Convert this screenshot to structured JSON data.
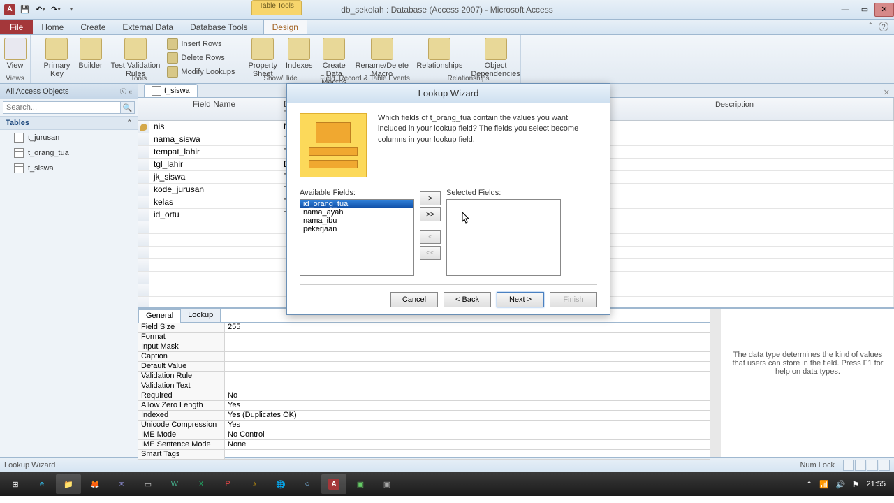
{
  "title": "db_sekolah : Database (Access 2007) - Microsoft Access",
  "tableTools": "Table Tools",
  "tabs": {
    "file": "File",
    "home": "Home",
    "create": "Create",
    "external": "External Data",
    "dbtools": "Database Tools",
    "design": "Design"
  },
  "ribbon": {
    "view": "View",
    "primaryKey": "Primary\nKey",
    "builder": "Builder",
    "testRules": "Test Validation\nRules",
    "insertRows": "Insert Rows",
    "deleteRows": "Delete Rows",
    "modifyLookups": "Modify Lookups",
    "propertySheet": "Property\nSheet",
    "indexes": "Indexes",
    "createMacros": "Create Data\nMacros ▾",
    "renameMacro": "Rename/Delete\nMacro",
    "relationships": "Relationships",
    "objectDeps": "Object\nDependencies",
    "groups": {
      "views": "Views",
      "tools": "Tools",
      "showhide": "Show/Hide",
      "fre": "Field, Record & Table Events",
      "rel": "Relationships"
    }
  },
  "nav": {
    "header": "All Access Objects",
    "searchPlaceholder": "Search...",
    "tables": "Tables",
    "items": [
      "t_jurusan",
      "t_orang_tua",
      "t_siswa"
    ]
  },
  "doc": {
    "tab": "t_siswa",
    "headers": {
      "field": "Field Name",
      "type": "Data Type",
      "desc": "Description"
    },
    "rows": [
      {
        "name": "nis",
        "type": "N",
        "pk": true
      },
      {
        "name": "nama_siswa",
        "type": "T"
      },
      {
        "name": "tempat_lahir",
        "type": "T"
      },
      {
        "name": "tgl_lahir",
        "type": "D"
      },
      {
        "name": "jk_siswa",
        "type": "T"
      },
      {
        "name": "kode_jurusan",
        "type": "T"
      },
      {
        "name": "kelas",
        "type": "T"
      },
      {
        "name": "id_ortu",
        "type": "T"
      }
    ]
  },
  "props": {
    "tabs": {
      "general": "General",
      "lookup": "Lookup"
    },
    "rows": [
      {
        "l": "Field Size",
        "v": "255"
      },
      {
        "l": "Format",
        "v": ""
      },
      {
        "l": "Input Mask",
        "v": ""
      },
      {
        "l": "Caption",
        "v": ""
      },
      {
        "l": "Default Value",
        "v": ""
      },
      {
        "l": "Validation Rule",
        "v": ""
      },
      {
        "l": "Validation Text",
        "v": ""
      },
      {
        "l": "Required",
        "v": "No"
      },
      {
        "l": "Allow Zero Length",
        "v": "Yes"
      },
      {
        "l": "Indexed",
        "v": "Yes (Duplicates OK)"
      },
      {
        "l": "Unicode Compression",
        "v": "Yes"
      },
      {
        "l": "IME Mode",
        "v": "No Control"
      },
      {
        "l": "IME Sentence Mode",
        "v": "None"
      },
      {
        "l": "Smart Tags",
        "v": ""
      }
    ],
    "help": "The data type determines the kind of values that users can store in the field. Press F1 for help on data types."
  },
  "wizard": {
    "title": "Lookup Wizard",
    "prompt": "Which fields of t_orang_tua contain the values you want included in your lookup field? The fields you select become columns in your lookup field.",
    "availLabel": "Available Fields:",
    "selLabel": "Selected Fields:",
    "available": [
      "id_orang_tua",
      "nama_ayah",
      "nama_ibu",
      "pekerjaan"
    ],
    "btns": {
      "add": ">",
      "addAll": ">>",
      "remove": "<",
      "removeAll": "<<"
    },
    "buttons": {
      "cancel": "Cancel",
      "back": "< Back",
      "next": "Next >",
      "finish": "Finish"
    }
  },
  "status": {
    "left": "Lookup Wizard",
    "numlock": "Num Lock"
  },
  "tray": {
    "time": "21:55"
  }
}
